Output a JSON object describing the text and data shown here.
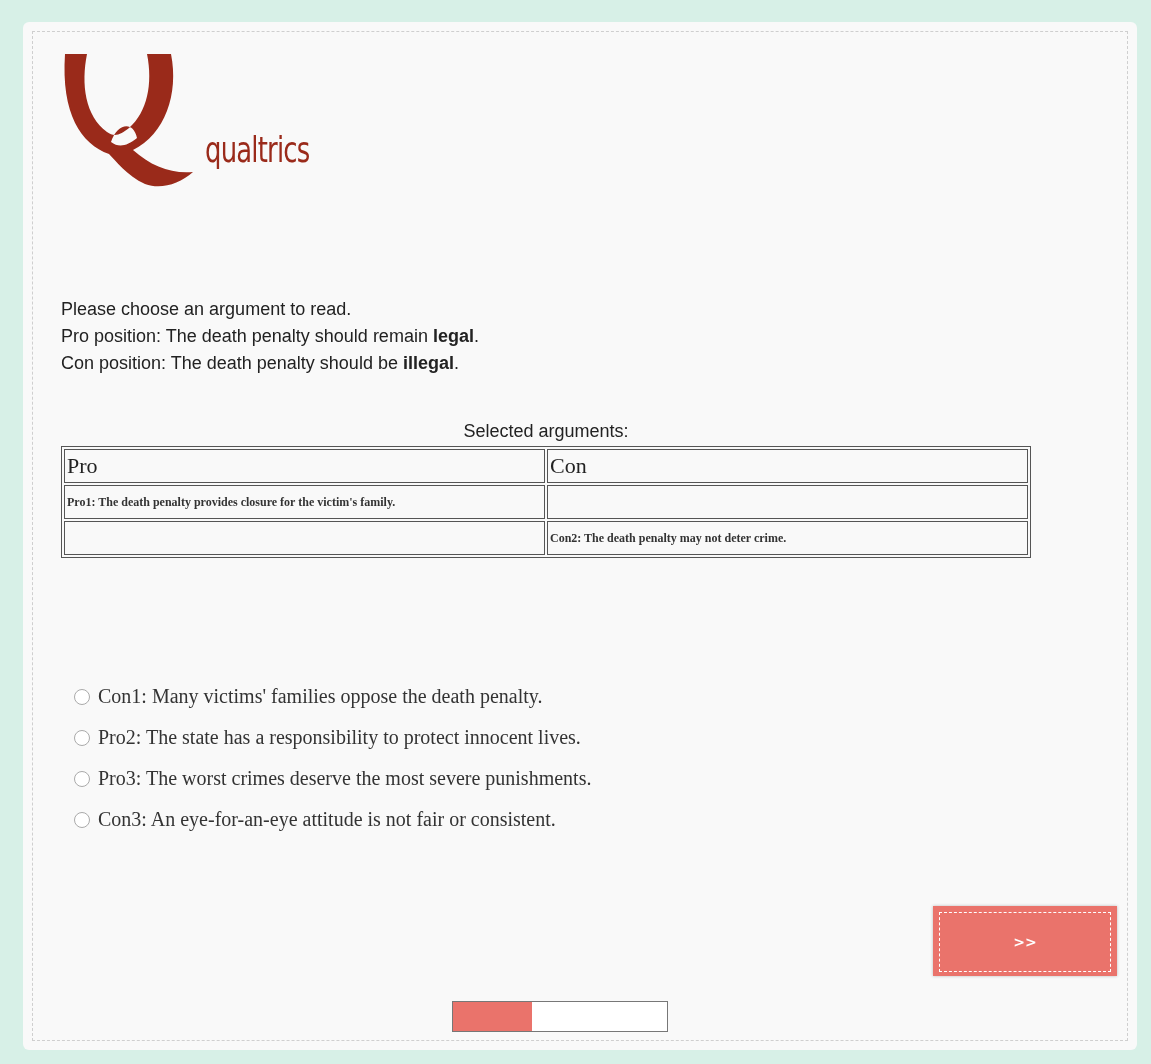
{
  "logo": {
    "wordmark": "qualtrics"
  },
  "intro": [
    "Please choose an argument to read.",
    "Pro position: The death penalty should remain **legal**.",
    "Con position: The death penalty should be **illegal**."
  ],
  "table": {
    "caption": "Selected arguments:",
    "columns": [
      "Pro",
      "Con"
    ],
    "rows": [
      [
        "Pro1: The death penalty provides closure for the victim's family.",
        ""
      ],
      [
        "",
        "Con2: The death penalty may not deter crime."
      ]
    ]
  },
  "choices": [
    {
      "label": "Con1: Many victims' families oppose the death penalty.",
      "selected": false
    },
    {
      "label": "Pro2: The state has a responsibility to protect innocent lives.",
      "selected": false
    },
    {
      "label": "Pro3: The worst crimes deserve the most severe punishments.",
      "selected": false
    },
    {
      "label": "Con3: An eye-for-an-eye attitude is not fair or consistent.",
      "selected": false
    }
  ],
  "next_button": ">>",
  "progress": {
    "level": 0.37
  }
}
